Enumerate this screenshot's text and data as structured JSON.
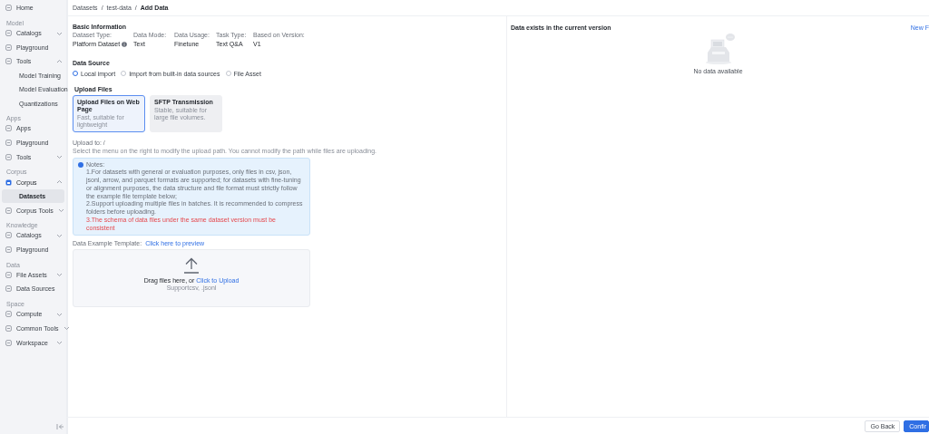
{
  "sidebar": {
    "items": [
      {
        "kind": "item",
        "label": "Home"
      },
      {
        "kind": "section",
        "label": "Model"
      },
      {
        "kind": "item",
        "label": "Catalogs",
        "expanded": false
      },
      {
        "kind": "item",
        "label": "Playground"
      },
      {
        "kind": "item",
        "label": "Tools",
        "expanded": true,
        "children": [
          {
            "label": "Model Training",
            "selected": false
          },
          {
            "label": "Model Evaluation",
            "selected": false
          },
          {
            "label": "Quantizations",
            "selected": false
          }
        ]
      },
      {
        "kind": "section",
        "label": "Apps"
      },
      {
        "kind": "item",
        "label": "Apps"
      },
      {
        "kind": "item",
        "label": "Playground"
      },
      {
        "kind": "item",
        "label": "Tools",
        "expanded": false
      },
      {
        "kind": "section",
        "label": "Corpus"
      },
      {
        "kind": "item",
        "label": "Corpus",
        "expanded": true,
        "children": [
          {
            "label": "Datasets",
            "selected": true
          }
        ]
      },
      {
        "kind": "item",
        "label": "Corpus Tools",
        "expanded": false
      },
      {
        "kind": "section",
        "label": "Knowledge"
      },
      {
        "kind": "item",
        "label": "Catalogs",
        "expanded": false
      },
      {
        "kind": "item",
        "label": "Playground"
      },
      {
        "kind": "section",
        "label": "Data"
      },
      {
        "kind": "item",
        "label": "File Assets",
        "expanded": false
      },
      {
        "kind": "item",
        "label": "Data Sources"
      },
      {
        "kind": "section",
        "label": "Space"
      },
      {
        "kind": "item",
        "label": "Compute",
        "expanded": false
      },
      {
        "kind": "item",
        "label": "Common Tools",
        "expanded": false
      },
      {
        "kind": "item",
        "label": "Workspace",
        "expanded": false
      }
    ]
  },
  "breadcrumb": {
    "separator": "/",
    "items": [
      {
        "label": "Datasets",
        "current": false
      },
      {
        "label": "test-data",
        "current": false
      },
      {
        "label": "Add Data",
        "current": true
      }
    ]
  },
  "basic_information": {
    "title": "Basic Information",
    "fields": [
      {
        "label": "Dataset Type:",
        "value": "Platform Dataset",
        "info": true
      },
      {
        "label": "Data Mode:",
        "value": "Text",
        "info": false
      },
      {
        "label": "Data Usage:",
        "value": "Finetune",
        "info": false
      },
      {
        "label": "Task Type:",
        "value": "Text Q&A",
        "info": false
      },
      {
        "label": "Based on Version:",
        "value": "V1",
        "info": false
      }
    ]
  },
  "data_source": {
    "title": "Data Source",
    "options": [
      {
        "label": "Local import",
        "selected": true
      },
      {
        "label": "Import from built-in data sources",
        "selected": false
      },
      {
        "label": "File Asset",
        "selected": false
      }
    ]
  },
  "upload_files": {
    "title": "Upload Files",
    "methods": [
      {
        "title": "Upload Files on Web Page",
        "description": "Fast, suitable for lightweight",
        "selected": true
      },
      {
        "title": "SFTP Transmission",
        "description": "Stable, suitable for large file volumes.",
        "selected": false
      }
    ]
  },
  "upload_to": {
    "label": "Upload to:",
    "value": "/",
    "hint": "Select the menu on the right to modify the upload path. You cannot modify the path while files are uploading."
  },
  "notes": {
    "title": "Notes:",
    "items": [
      {
        "kind": "normal",
        "text": "1.For datasets with general or evaluation purposes, only files in csv, json, jsonl, arrow, and parquet formats are supported; for datasets with fine-tuning or alignment purposes, the data structure and file format must strictly follow the example file template below;"
      },
      {
        "kind": "normal",
        "text": "2.Support uploading multiple files in batches. It is recommended to compress folders before uploading."
      },
      {
        "kind": "warning",
        "text": "3.The schema of data files under the same dataset version must be consistent"
      }
    ]
  },
  "template": {
    "label": "Data Example Template:",
    "link": "Click here to preview"
  },
  "dropzone": {
    "text": "Drag files here, or",
    "link": "Click to Upload",
    "formats": "Supportcsv, .jsonl"
  },
  "version_panel": {
    "title": "Data exists in the current version",
    "action": "New F",
    "empty_text": "No data available"
  },
  "footer": {
    "buttons": [
      {
        "label": "Go Back",
        "kind": "secondary"
      },
      {
        "label": "Confir",
        "kind": "primary"
      }
    ]
  }
}
